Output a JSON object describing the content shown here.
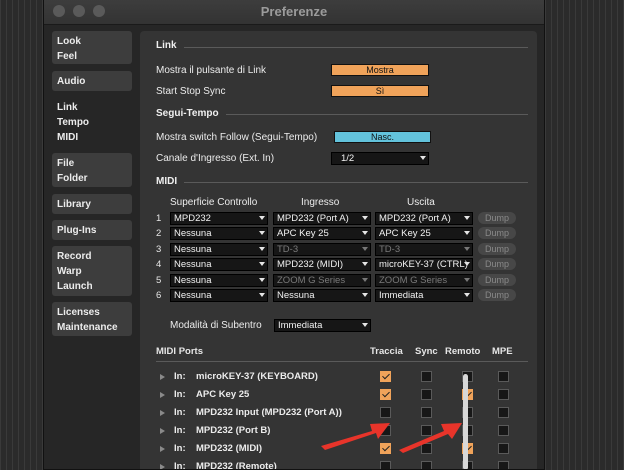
{
  "window": {
    "title": "Preferenze"
  },
  "sidebar": {
    "tabs": [
      {
        "lines": [
          "Look",
          "Feel"
        ]
      },
      {
        "lines": [
          "Audio"
        ]
      },
      {
        "lines": [
          "Link",
          "Tempo",
          "MIDI"
        ]
      },
      {
        "lines": [
          "File",
          "Folder"
        ]
      },
      {
        "lines": [
          "Library"
        ]
      },
      {
        "lines": [
          "Plug-Ins"
        ]
      },
      {
        "lines": [
          "Record",
          "Warp",
          "Launch"
        ]
      },
      {
        "lines": [
          "Licenses",
          "Maintenance"
        ]
      }
    ],
    "active_index": 2
  },
  "link": {
    "section": "Link",
    "show_button_label": "Mostra il pulsante di Link",
    "show_button_value": "Mostra",
    "start_stop_label": "Start Stop Sync",
    "start_stop_value": "Sì"
  },
  "follow": {
    "section": "Segui-Tempo",
    "switch_label": "Mostra switch Follow (Segui-Tempo)",
    "switch_value": "Nasc.",
    "channel_label": "Canale d'Ingresso (Ext. In)",
    "channel_value": "1/2"
  },
  "midi": {
    "section": "MIDI",
    "headers": {
      "surface": "Superficie Controllo",
      "input": "Ingresso",
      "output": "Uscita"
    },
    "dump_label": "Dump",
    "rows": [
      {
        "n": "1",
        "surface": "MPD232",
        "input": "MPD232 (Port A)",
        "output": "MPD232 (Port A)"
      },
      {
        "n": "2",
        "surface": "Nessuna",
        "input": "APC Key 25",
        "output": "APC Key 25"
      },
      {
        "n": "3",
        "surface": "Nessuna",
        "input": "TD-3",
        "output": "TD-3"
      },
      {
        "n": "4",
        "surface": "Nessuna",
        "input": "MPD232 (MIDI)",
        "output": "microKEY-37 (CTRL)"
      },
      {
        "n": "5",
        "surface": "Nessuna",
        "input": "ZOOM G Series",
        "output": "ZOOM G Series"
      },
      {
        "n": "6",
        "surface": "Nessuna",
        "input": "Nessuna",
        "output": "Immediata"
      }
    ],
    "takeover_label": "Modalità di Subentro",
    "takeover_value": "Immediata"
  },
  "ports": {
    "title": "MIDI Ports",
    "cols": [
      "Traccia",
      "Sync",
      "Remoto",
      "MPE"
    ],
    "rows": [
      {
        "dir": "In:",
        "name": "microKEY-37 (KEYBOARD)",
        "checks": [
          true,
          false,
          false,
          false
        ]
      },
      {
        "dir": "In:",
        "name": "APC Key 25",
        "checks": [
          true,
          false,
          true,
          false
        ]
      },
      {
        "dir": "In:",
        "name": "MPD232 Input (MPD232 (Port A))",
        "checks": [
          false,
          false,
          false,
          false
        ]
      },
      {
        "dir": "In:",
        "name": "MPD232 (Port B)",
        "checks": [
          false,
          false,
          false,
          false
        ]
      },
      {
        "dir": "In:",
        "name": "MPD232 (MIDI)",
        "checks": [
          true,
          false,
          true,
          false
        ]
      },
      {
        "dir": "In:",
        "name": "MPD232 (Remote)",
        "checks": [
          false,
          false,
          false,
          false
        ]
      }
    ]
  },
  "colors": {
    "accent": "#f0a35a",
    "blue": "#63c3dc",
    "arrow": "#e8342a"
  }
}
